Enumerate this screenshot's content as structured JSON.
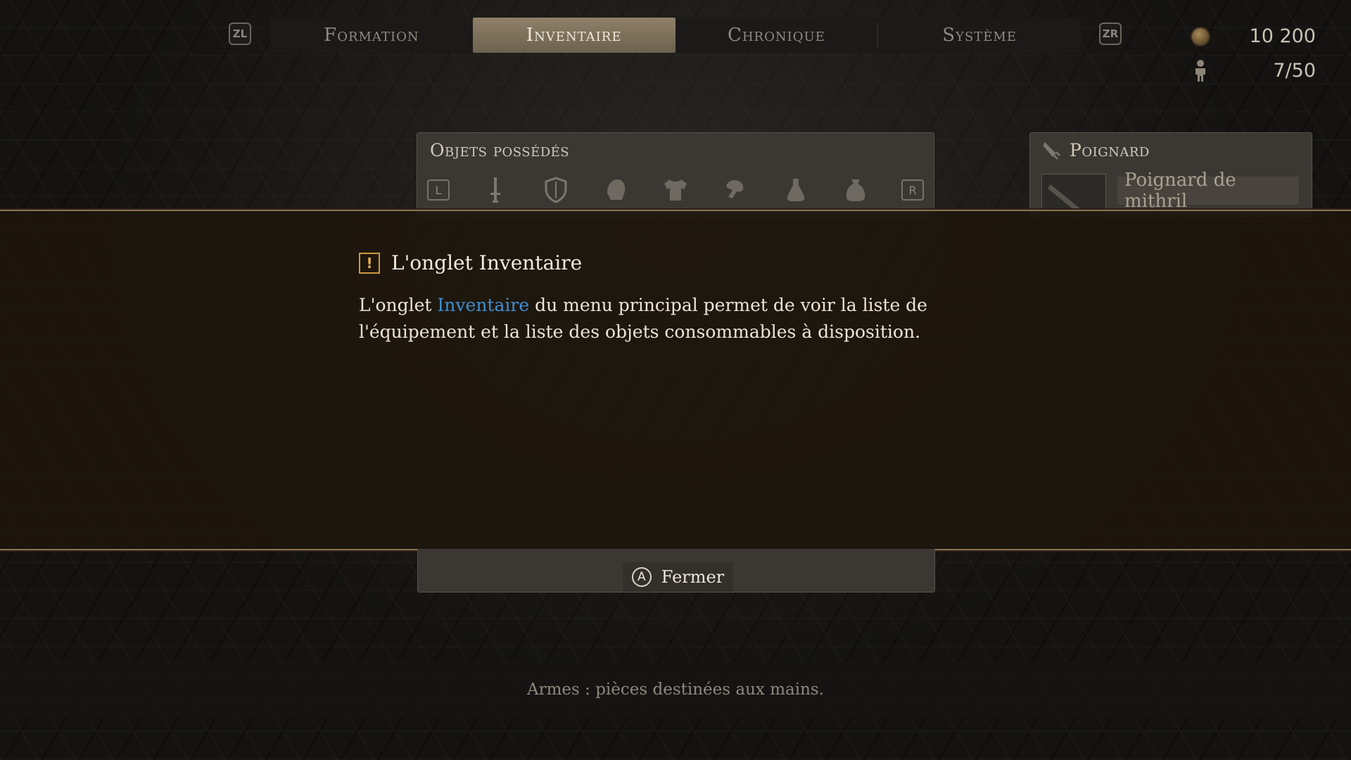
{
  "header": {
    "left_shoulder": "ZL",
    "right_shoulder": "ZR",
    "tabs": [
      {
        "label": "Formation",
        "active": false
      },
      {
        "label": "Inventaire",
        "active": true
      },
      {
        "label": "Chronique",
        "active": false
      },
      {
        "label": "Système",
        "active": false
      }
    ]
  },
  "stats": {
    "gold": "10 200",
    "party": "7/50",
    "gold_icon": "coin-icon",
    "party_icon": "person-icon"
  },
  "inventory_panel": {
    "title": "Objets possédés",
    "left_button": "L",
    "right_button": "R",
    "categories": [
      "weapon-icon",
      "shield-icon",
      "helmet-icon",
      "armor-icon",
      "accessory-icon",
      "potion-icon",
      "bag-icon"
    ]
  },
  "detail_panel": {
    "title": "Poignard",
    "item_name": "Poignard de mithril"
  },
  "tip": {
    "title": "L'onglet Inventaire",
    "body_before": "L'onglet ",
    "body_keyword": "Inventaire",
    "body_after": " du menu principal permet de voir la liste de l'équipement et la liste des objets consommables à disposition.",
    "keyword_color": "#3d8fd6",
    "icon": "warning-icon"
  },
  "close": {
    "button_glyph": "A",
    "label": "Fermer"
  },
  "help": {
    "text": "Armes : pièces destinées aux mains."
  }
}
